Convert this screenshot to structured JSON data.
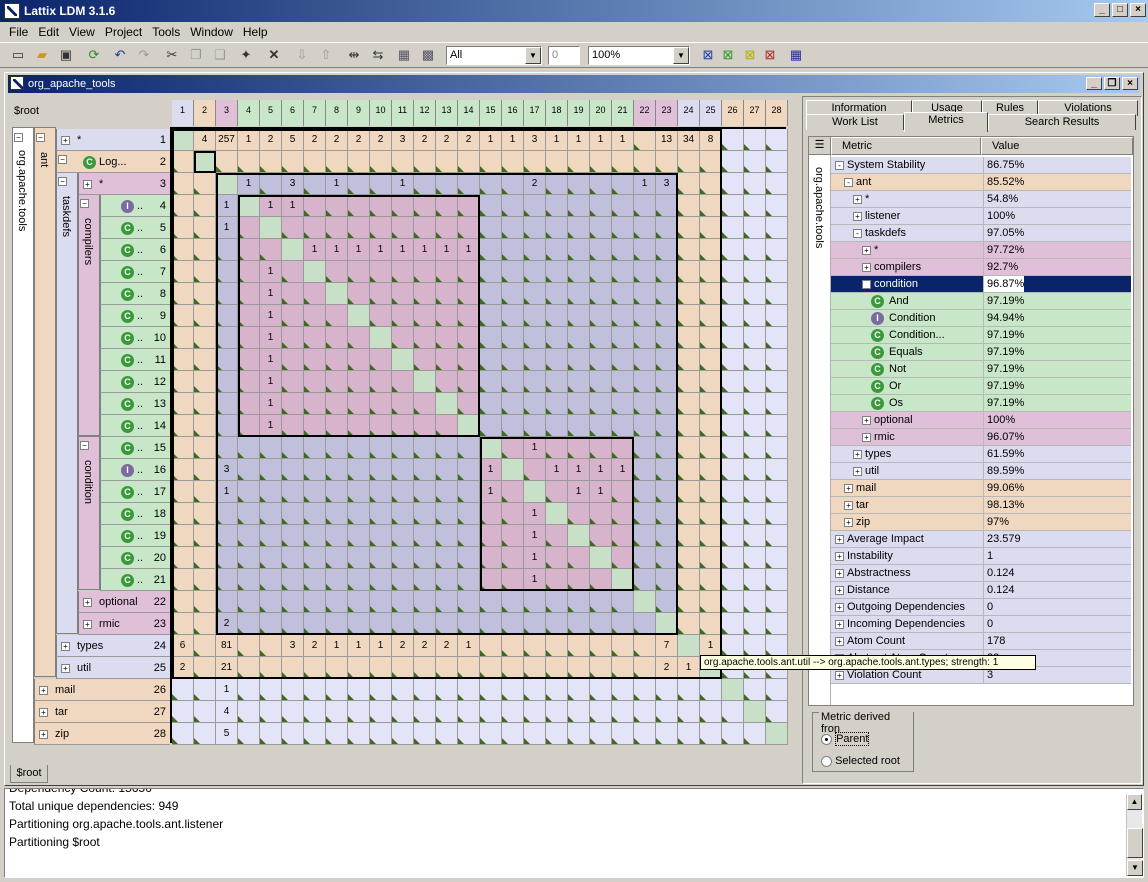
{
  "app": {
    "title": "Lattix LDM 3.1.6"
  },
  "menu": [
    "File",
    "Edit",
    "View",
    "Project",
    "Tools",
    "Window",
    "Help"
  ],
  "toolbar": {
    "filter_value": "All",
    "spin_value": "0",
    "zoom_value": "100%"
  },
  "doc": {
    "title": "org_apache_tools",
    "root_label": "$root",
    "bottom_tab": "$root"
  },
  "columns": [
    "1",
    "2",
    "3",
    "4",
    "5",
    "6",
    "7",
    "8",
    "9",
    "10",
    "11",
    "12",
    "13",
    "14",
    "15",
    "16",
    "17",
    "18",
    "19",
    "20",
    "21",
    "22",
    "23",
    "24",
    "25",
    "26",
    "27",
    "28"
  ],
  "row_labels": [
    {
      "n": "1",
      "label": "*",
      "icon": "plus"
    },
    {
      "n": "2",
      "label": "Log...",
      "icon": "class"
    },
    {
      "n": "3",
      "label": "*",
      "icon": "plus"
    },
    {
      "n": "4",
      "label": "..",
      "icon": "interface"
    },
    {
      "n": "5",
      "label": "..",
      "icon": "class"
    },
    {
      "n": "6",
      "label": "..",
      "icon": "class"
    },
    {
      "n": "7",
      "label": "..",
      "icon": "class"
    },
    {
      "n": "8",
      "label": "..",
      "icon": "class"
    },
    {
      "n": "9",
      "label": "..",
      "icon": "class"
    },
    {
      "n": "10",
      "label": "..",
      "icon": "class"
    },
    {
      "n": "11",
      "label": "..",
      "icon": "class"
    },
    {
      "n": "12",
      "label": "..",
      "icon": "class"
    },
    {
      "n": "13",
      "label": "..",
      "icon": "class"
    },
    {
      "n": "14",
      "label": "..",
      "icon": "class"
    },
    {
      "n": "15",
      "label": "..",
      "icon": "class"
    },
    {
      "n": "16",
      "label": "..",
      "icon": "interface"
    },
    {
      "n": "17",
      "label": "..",
      "icon": "class"
    },
    {
      "n": "18",
      "label": "..",
      "icon": "class"
    },
    {
      "n": "19",
      "label": "..",
      "icon": "class"
    },
    {
      "n": "20",
      "label": "..",
      "icon": "class"
    },
    {
      "n": "21",
      "label": "..",
      "icon": "class"
    },
    {
      "n": "22",
      "label": "optional",
      "icon": "plus"
    },
    {
      "n": "23",
      "label": "rmic",
      "icon": "plus"
    },
    {
      "n": "24",
      "label": "types",
      "icon": "plus"
    },
    {
      "n": "25",
      "label": "util",
      "icon": "plus"
    },
    {
      "n": "26",
      "label": "mail",
      "icon": "plus"
    },
    {
      "n": "27",
      "label": "tar",
      "icon": "plus"
    },
    {
      "n": "28",
      "label": "zip",
      "icon": "plus"
    }
  ],
  "tree_groups": {
    "root": "org.apache.tools",
    "ant": "ant",
    "taskdefs": "taskdefs",
    "compilers": "compilers",
    "condition": "condition"
  },
  "cells": [
    [
      1,
      2,
      "4"
    ],
    [
      1,
      3,
      "257"
    ],
    [
      1,
      4,
      "1"
    ],
    [
      1,
      5,
      "2"
    ],
    [
      1,
      6,
      "5"
    ],
    [
      1,
      7,
      "2"
    ],
    [
      1,
      8,
      "2"
    ],
    [
      1,
      9,
      "2"
    ],
    [
      1,
      10,
      "2"
    ],
    [
      1,
      11,
      "3"
    ],
    [
      1,
      12,
      "2"
    ],
    [
      1,
      13,
      "2"
    ],
    [
      1,
      14,
      "2"
    ],
    [
      1,
      15,
      "1"
    ],
    [
      1,
      16,
      "1"
    ],
    [
      1,
      17,
      "3"
    ],
    [
      1,
      18,
      "1"
    ],
    [
      1,
      19,
      "1"
    ],
    [
      1,
      20,
      "1"
    ],
    [
      1,
      21,
      "1"
    ],
    [
      1,
      23,
      "13"
    ],
    [
      1,
      24,
      "34"
    ],
    [
      1,
      25,
      "8"
    ],
    [
      3,
      4,
      "1"
    ],
    [
      3,
      6,
      "3"
    ],
    [
      3,
      8,
      "1"
    ],
    [
      3,
      11,
      "1"
    ],
    [
      3,
      17,
      "2"
    ],
    [
      3,
      22,
      "1"
    ],
    [
      3,
      23,
      "3"
    ],
    [
      4,
      3,
      "1"
    ],
    [
      4,
      5,
      "1"
    ],
    [
      4,
      6,
      "1"
    ],
    [
      5,
      3,
      "1"
    ],
    [
      6,
      7,
      "1"
    ],
    [
      6,
      8,
      "1"
    ],
    [
      6,
      9,
      "1"
    ],
    [
      6,
      10,
      "1"
    ],
    [
      6,
      11,
      "1"
    ],
    [
      6,
      12,
      "1"
    ],
    [
      6,
      13,
      "1"
    ],
    [
      6,
      14,
      "1"
    ],
    [
      7,
      5,
      "1"
    ],
    [
      8,
      5,
      "1"
    ],
    [
      9,
      5,
      "1"
    ],
    [
      10,
      5,
      "1"
    ],
    [
      11,
      5,
      "1"
    ],
    [
      12,
      5,
      "1"
    ],
    [
      13,
      5,
      "1"
    ],
    [
      14,
      5,
      "1"
    ],
    [
      15,
      17,
      "1"
    ],
    [
      16,
      3,
      "3"
    ],
    [
      16,
      15,
      "1"
    ],
    [
      16,
      18,
      "1"
    ],
    [
      16,
      19,
      "1"
    ],
    [
      16,
      20,
      "1"
    ],
    [
      16,
      21,
      "1"
    ],
    [
      17,
      3,
      "1"
    ],
    [
      17,
      15,
      "1"
    ],
    [
      17,
      19,
      "1"
    ],
    [
      17,
      20,
      "1"
    ],
    [
      18,
      17,
      "1"
    ],
    [
      19,
      17,
      "1"
    ],
    [
      20,
      17,
      "1"
    ],
    [
      21,
      17,
      "1"
    ],
    [
      23,
      3,
      "2"
    ],
    [
      24,
      1,
      "6"
    ],
    [
      24,
      3,
      "81"
    ],
    [
      24,
      6,
      "3"
    ],
    [
      24,
      7,
      "2"
    ],
    [
      24,
      8,
      "1"
    ],
    [
      24,
      9,
      "1"
    ],
    [
      24,
      10,
      "1"
    ],
    [
      24,
      11,
      "2"
    ],
    [
      24,
      12,
      "2"
    ],
    [
      24,
      13,
      "2"
    ],
    [
      24,
      14,
      "1"
    ],
    [
      24,
      23,
      "7"
    ],
    [
      24,
      25,
      "1"
    ],
    [
      25,
      1,
      "2"
    ],
    [
      25,
      3,
      "21"
    ],
    [
      25,
      23,
      "2"
    ],
    [
      25,
      24,
      "1"
    ],
    [
      26,
      3,
      "1"
    ],
    [
      27,
      3,
      "4"
    ],
    [
      28,
      3,
      "5"
    ]
  ],
  "tabs": {
    "row1": [
      "Information",
      "Usage",
      "Rules",
      "Violations"
    ],
    "row2": [
      "Work List",
      "Metrics",
      "Search Results"
    ],
    "active": "Metrics"
  },
  "metrics": {
    "header_metric": "Metric",
    "header_value": "Value",
    "vertical_label": "org.apache.tools",
    "rows": [
      {
        "indent": 0,
        "label": "System Stability",
        "value": "86.75%",
        "exp": "-",
        "bg": "#dcdcf0"
      },
      {
        "indent": 1,
        "label": "ant",
        "value": "85.52%",
        "exp": "-",
        "bg": "#f0d8c0"
      },
      {
        "indent": 2,
        "label": "*",
        "value": "54.8%",
        "exp": "+",
        "bg": "#dcdcf0"
      },
      {
        "indent": 2,
        "label": "listener",
        "value": "100%",
        "exp": "+",
        "bg": "#dcdcf0"
      },
      {
        "indent": 2,
        "label": "taskdefs",
        "value": "97.05%",
        "exp": "-",
        "bg": "#dcdcf0"
      },
      {
        "indent": 3,
        "label": "*",
        "value": "97.72%",
        "exp": "+",
        "bg": "#e0c0d8"
      },
      {
        "indent": 3,
        "label": "compilers",
        "value": "92.7%",
        "exp": "+",
        "bg": "#e0c0d8"
      },
      {
        "indent": 3,
        "label": "condition",
        "value": "96.87%",
        "exp": "-",
        "bg": "#0a246a",
        "sel": true
      },
      {
        "indent": 4,
        "label": "And",
        "value": "97.19%",
        "icon": "class",
        "bg": "#c8e6c8"
      },
      {
        "indent": 4,
        "label": "Condition",
        "value": "94.94%",
        "icon": "interface",
        "bg": "#c8e6c8"
      },
      {
        "indent": 4,
        "label": "Condition...",
        "value": "97.19%",
        "icon": "class",
        "bg": "#c8e6c8"
      },
      {
        "indent": 4,
        "label": "Equals",
        "value": "97.19%",
        "icon": "class",
        "bg": "#c8e6c8"
      },
      {
        "indent": 4,
        "label": "Not",
        "value": "97.19%",
        "icon": "class",
        "bg": "#c8e6c8"
      },
      {
        "indent": 4,
        "label": "Or",
        "value": "97.19%",
        "icon": "class",
        "bg": "#c8e6c8"
      },
      {
        "indent": 4,
        "label": "Os",
        "value": "97.19%",
        "icon": "class",
        "bg": "#c8e6c8"
      },
      {
        "indent": 3,
        "label": "optional",
        "value": "100%",
        "exp": "+",
        "bg": "#e0c0d8"
      },
      {
        "indent": 3,
        "label": "rmic",
        "value": "96.07%",
        "exp": "+",
        "bg": "#e0c0d8"
      },
      {
        "indent": 2,
        "label": "types",
        "value": "61.59%",
        "exp": "+",
        "bg": "#dcdcf0"
      },
      {
        "indent": 2,
        "label": "util",
        "value": "89.59%",
        "exp": "+",
        "bg": "#dcdcf0"
      },
      {
        "indent": 1,
        "label": "mail",
        "value": "99.06%",
        "exp": "+",
        "bg": "#f0d8c0"
      },
      {
        "indent": 1,
        "label": "tar",
        "value": "98.13%",
        "exp": "+",
        "bg": "#f0d8c0"
      },
      {
        "indent": 1,
        "label": "zip",
        "value": "97%",
        "exp": "+",
        "bg": "#f0d8c0"
      },
      {
        "indent": 0,
        "label": "Average Impact",
        "value": "23.579",
        "exp": "+",
        "bg": "#dcdcf0"
      },
      {
        "indent": 0,
        "label": "Instability",
        "value": "1",
        "exp": "+",
        "bg": "#dcdcf0"
      },
      {
        "indent": 0,
        "label": "Abstractness",
        "value": "0.124",
        "exp": "+",
        "bg": "#dcdcf0"
      },
      {
        "indent": 0,
        "label": "Distance",
        "value": "0.124",
        "exp": "+",
        "bg": "#dcdcf0"
      },
      {
        "indent": 0,
        "label": "Outgoing Dependencies",
        "value": "0",
        "exp": "+",
        "bg": "#dcdcf0"
      },
      {
        "indent": 0,
        "label": "Incoming Dependencies",
        "value": "0",
        "exp": "+",
        "bg": "#dcdcf0"
      },
      {
        "indent": 0,
        "label": "Atom Count",
        "value": "178",
        "exp": "+",
        "bg": "#dcdcf0"
      },
      {
        "indent": 0,
        "label": "Abstract Atom Count",
        "value": "22",
        "exp": "+",
        "bg": "#dcdcf0"
      },
      {
        "indent": 0,
        "label": "Violation Count",
        "value": "3",
        "exp": "+",
        "bg": "#dcdcf0"
      }
    ]
  },
  "derived": {
    "legend": "Metric derived fron",
    "parent": "Parent",
    "selected": "Selected root"
  },
  "tooltip": "org.apache.tools.ant.util --> org.apache.tools.ant.types; strength: 1",
  "console": [
    "Dependency Count: 15656",
    "Total unique dependencies: 949",
    "Partitioning org.apache.tools.ant.listener",
    "Partitioning $root"
  ]
}
